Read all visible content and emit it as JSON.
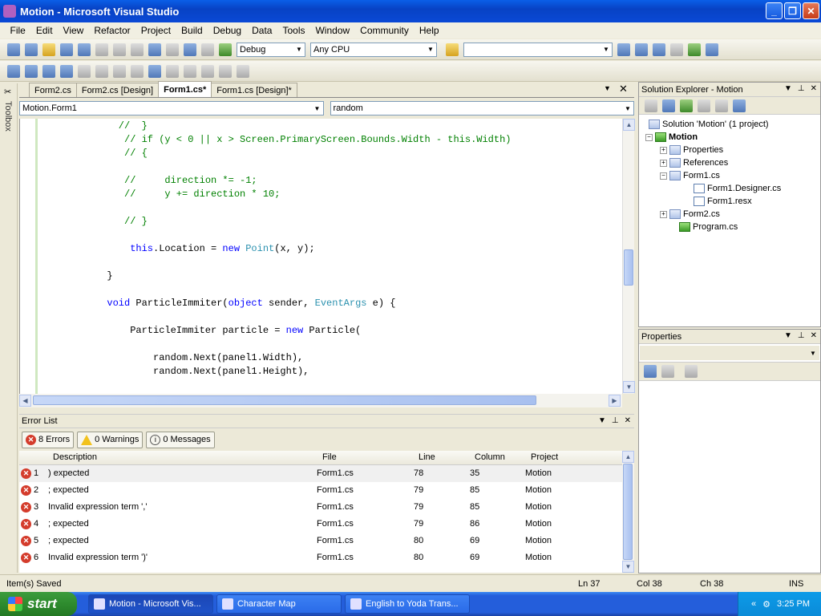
{
  "window": {
    "title": "Motion - Microsoft Visual Studio"
  },
  "menu": [
    "File",
    "Edit",
    "View",
    "Refactor",
    "Project",
    "Build",
    "Debug",
    "Data",
    "Tools",
    "Window",
    "Community",
    "Help"
  ],
  "toolbar": {
    "config": "Debug",
    "platform": "Any CPU",
    "find": ""
  },
  "toolbox_label": "Toolbox",
  "editor": {
    "tabs": [
      "Form2.cs",
      "Form2.cs [Design]",
      "Form1.cs*",
      "Form1.cs [Design]*"
    ],
    "active_tab": 2,
    "class_combo": "Motion.Form1",
    "member_combo": "random",
    "lines": [
      {
        "text": "//  }",
        "cls": "cm",
        "indent": 14
      },
      {
        "text": "// if (y < 0 || x > Screen.PrimaryScreen.Bounds.Width - this.Width)",
        "cls": "cm",
        "indent": 15
      },
      {
        "text": "// {",
        "cls": "cm",
        "indent": 15
      },
      {
        "text": "",
        "cls": "",
        "indent": 0
      },
      {
        "text": "//     direction *= -1;",
        "cls": "cm",
        "indent": 15
      },
      {
        "text": "//     y += direction * 10;",
        "cls": "cm",
        "indent": 15
      },
      {
        "text": "",
        "cls": "",
        "indent": 0
      },
      {
        "text": "// }",
        "cls": "cm",
        "indent": 15
      },
      {
        "text": "",
        "cls": "",
        "indent": 0
      },
      {
        "text": "this.Location = new Point(x, y);",
        "cls": "mixed1",
        "indent": 16
      },
      {
        "text": "",
        "cls": "",
        "indent": 0
      },
      {
        "text": "}",
        "cls": "",
        "indent": 12
      },
      {
        "text": "",
        "cls": "",
        "indent": 0
      },
      {
        "text": "void ParticleImmiter(object sender, EventArgs e) {",
        "cls": "mixed2",
        "indent": 12
      },
      {
        "text": "",
        "cls": "",
        "indent": 0
      },
      {
        "text": "ParticleImmiter particle = new Particle(",
        "cls": "mixed3",
        "indent": 16
      },
      {
        "text": "",
        "cls": "",
        "indent": 0
      },
      {
        "text": "random.Next(panel1.Width),",
        "cls": "",
        "indent": 20
      },
      {
        "text": "random.Next(panel1.Height),",
        "cls": "",
        "indent": 20
      }
    ]
  },
  "error_list": {
    "title": "Error List",
    "filters": {
      "errors": "8 Errors",
      "warnings": "0 Warnings",
      "messages": "0 Messages"
    },
    "columns": [
      "Description",
      "File",
      "Line",
      "Column",
      "Project"
    ],
    "rows": [
      {
        "n": "1",
        "desc": ") expected",
        "file": "Form1.cs",
        "line": "78",
        "col": "35",
        "proj": "Motion"
      },
      {
        "n": "2",
        "desc": "; expected",
        "file": "Form1.cs",
        "line": "79",
        "col": "85",
        "proj": "Motion"
      },
      {
        "n": "3",
        "desc": "Invalid expression term ','",
        "file": "Form1.cs",
        "line": "79",
        "col": "85",
        "proj": "Motion"
      },
      {
        "n": "4",
        "desc": "; expected",
        "file": "Form1.cs",
        "line": "79",
        "col": "86",
        "proj": "Motion"
      },
      {
        "n": "5",
        "desc": "; expected",
        "file": "Form1.cs",
        "line": "80",
        "col": "69",
        "proj": "Motion"
      },
      {
        "n": "6",
        "desc": "Invalid expression term ')'",
        "file": "Form1.cs",
        "line": "80",
        "col": "69",
        "proj": "Motion"
      }
    ]
  },
  "solution_explorer": {
    "title": "Solution Explorer - Motion",
    "solution": "Solution 'Motion' (1 project)",
    "project": "Motion",
    "properties": "Properties",
    "references": "References",
    "form1": "Form1.cs",
    "form1_designer": "Form1.Designer.cs",
    "form1_resx": "Form1.resx",
    "form2": "Form2.cs",
    "program": "Program.cs"
  },
  "properties_panel": {
    "title": "Properties"
  },
  "status": {
    "message": "Item(s) Saved",
    "ln": "Ln 37",
    "col": "Col 38",
    "ch": "Ch 38",
    "mode": "INS"
  },
  "taskbar": {
    "start": "start",
    "tasks": [
      "Motion - Microsoft Vis...",
      "Character Map",
      "English to Yoda Trans..."
    ],
    "clock": "3:25 PM"
  }
}
